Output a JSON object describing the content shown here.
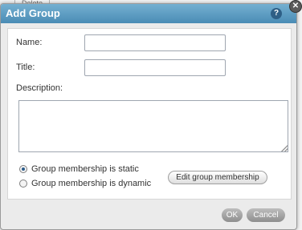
{
  "background": {
    "tab_label": "Delete",
    "fragment_left": "gr",
    "fragment_top": "r"
  },
  "dialog": {
    "title": "Add Group",
    "help_glyph": "?",
    "close_glyph": "✕"
  },
  "form": {
    "name_label": "Name:",
    "name_value": "",
    "title_label": "Title:",
    "title_value": "",
    "description_label": "Description:",
    "description_value": ""
  },
  "membership": {
    "static_label": "Group membership is static",
    "dynamic_label": "Group membership is dynamic",
    "selected": "static",
    "edit_button_label": "Edit group membership"
  },
  "footer": {
    "ok_label": "OK",
    "cancel_label": "Cancel"
  },
  "colors": {
    "titlebar": "#5f9fc6",
    "button_gray": "#a5a5a5"
  }
}
